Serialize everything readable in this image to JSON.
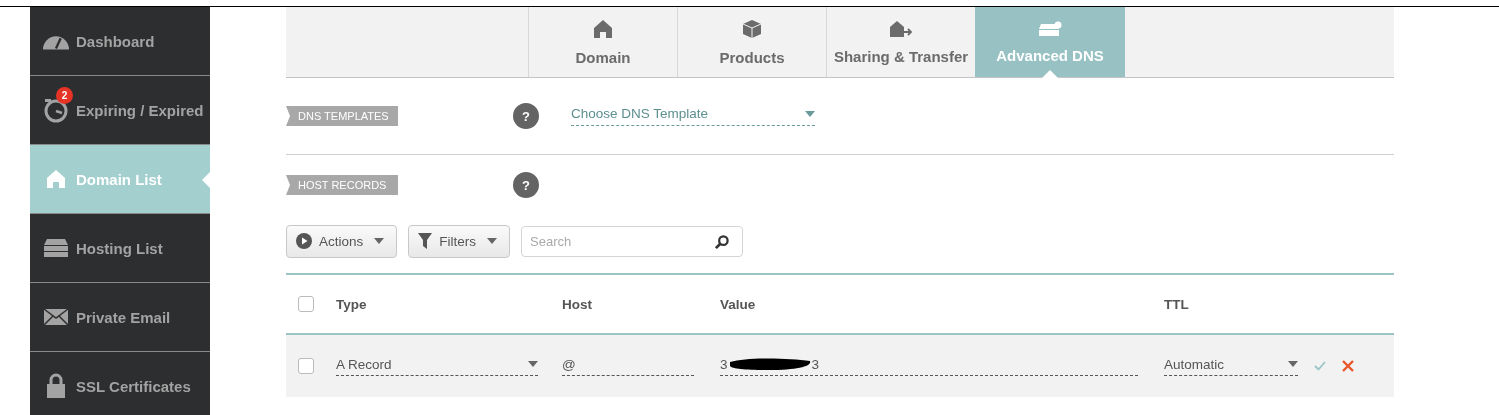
{
  "sidebar": {
    "items": [
      {
        "label": "Dashboard",
        "selected": false
      },
      {
        "label": "Expiring / Expired",
        "selected": false,
        "badge": "2"
      },
      {
        "label": "Domain List",
        "selected": true
      },
      {
        "label": "Hosting List",
        "selected": false
      },
      {
        "label": "Private Email",
        "selected": false
      },
      {
        "label": "SSL Certificates",
        "selected": false
      }
    ]
  },
  "tabs": [
    {
      "label": "Domain",
      "selected": false
    },
    {
      "label": "Products",
      "selected": false
    },
    {
      "label": "Sharing & Transfer",
      "selected": false
    },
    {
      "label": "Advanced DNS",
      "selected": true
    }
  ],
  "dns_templates": {
    "label": "DNS TEMPLATES",
    "help": "?",
    "select": "Choose DNS Template"
  },
  "host_records": {
    "label": "HOST RECORDS",
    "help": "?"
  },
  "toolbar": {
    "actions": "Actions",
    "filters": "Filters",
    "search_placeholder": "Search"
  },
  "table": {
    "columns": [
      "Type",
      "Host",
      "Value",
      "TTL"
    ],
    "all_checked": false,
    "rows": [
      {
        "checked": false,
        "type": "A Record",
        "host": "@",
        "value_start": "3",
        "value_end": "3",
        "ttl": "Automatic"
      }
    ]
  }
}
